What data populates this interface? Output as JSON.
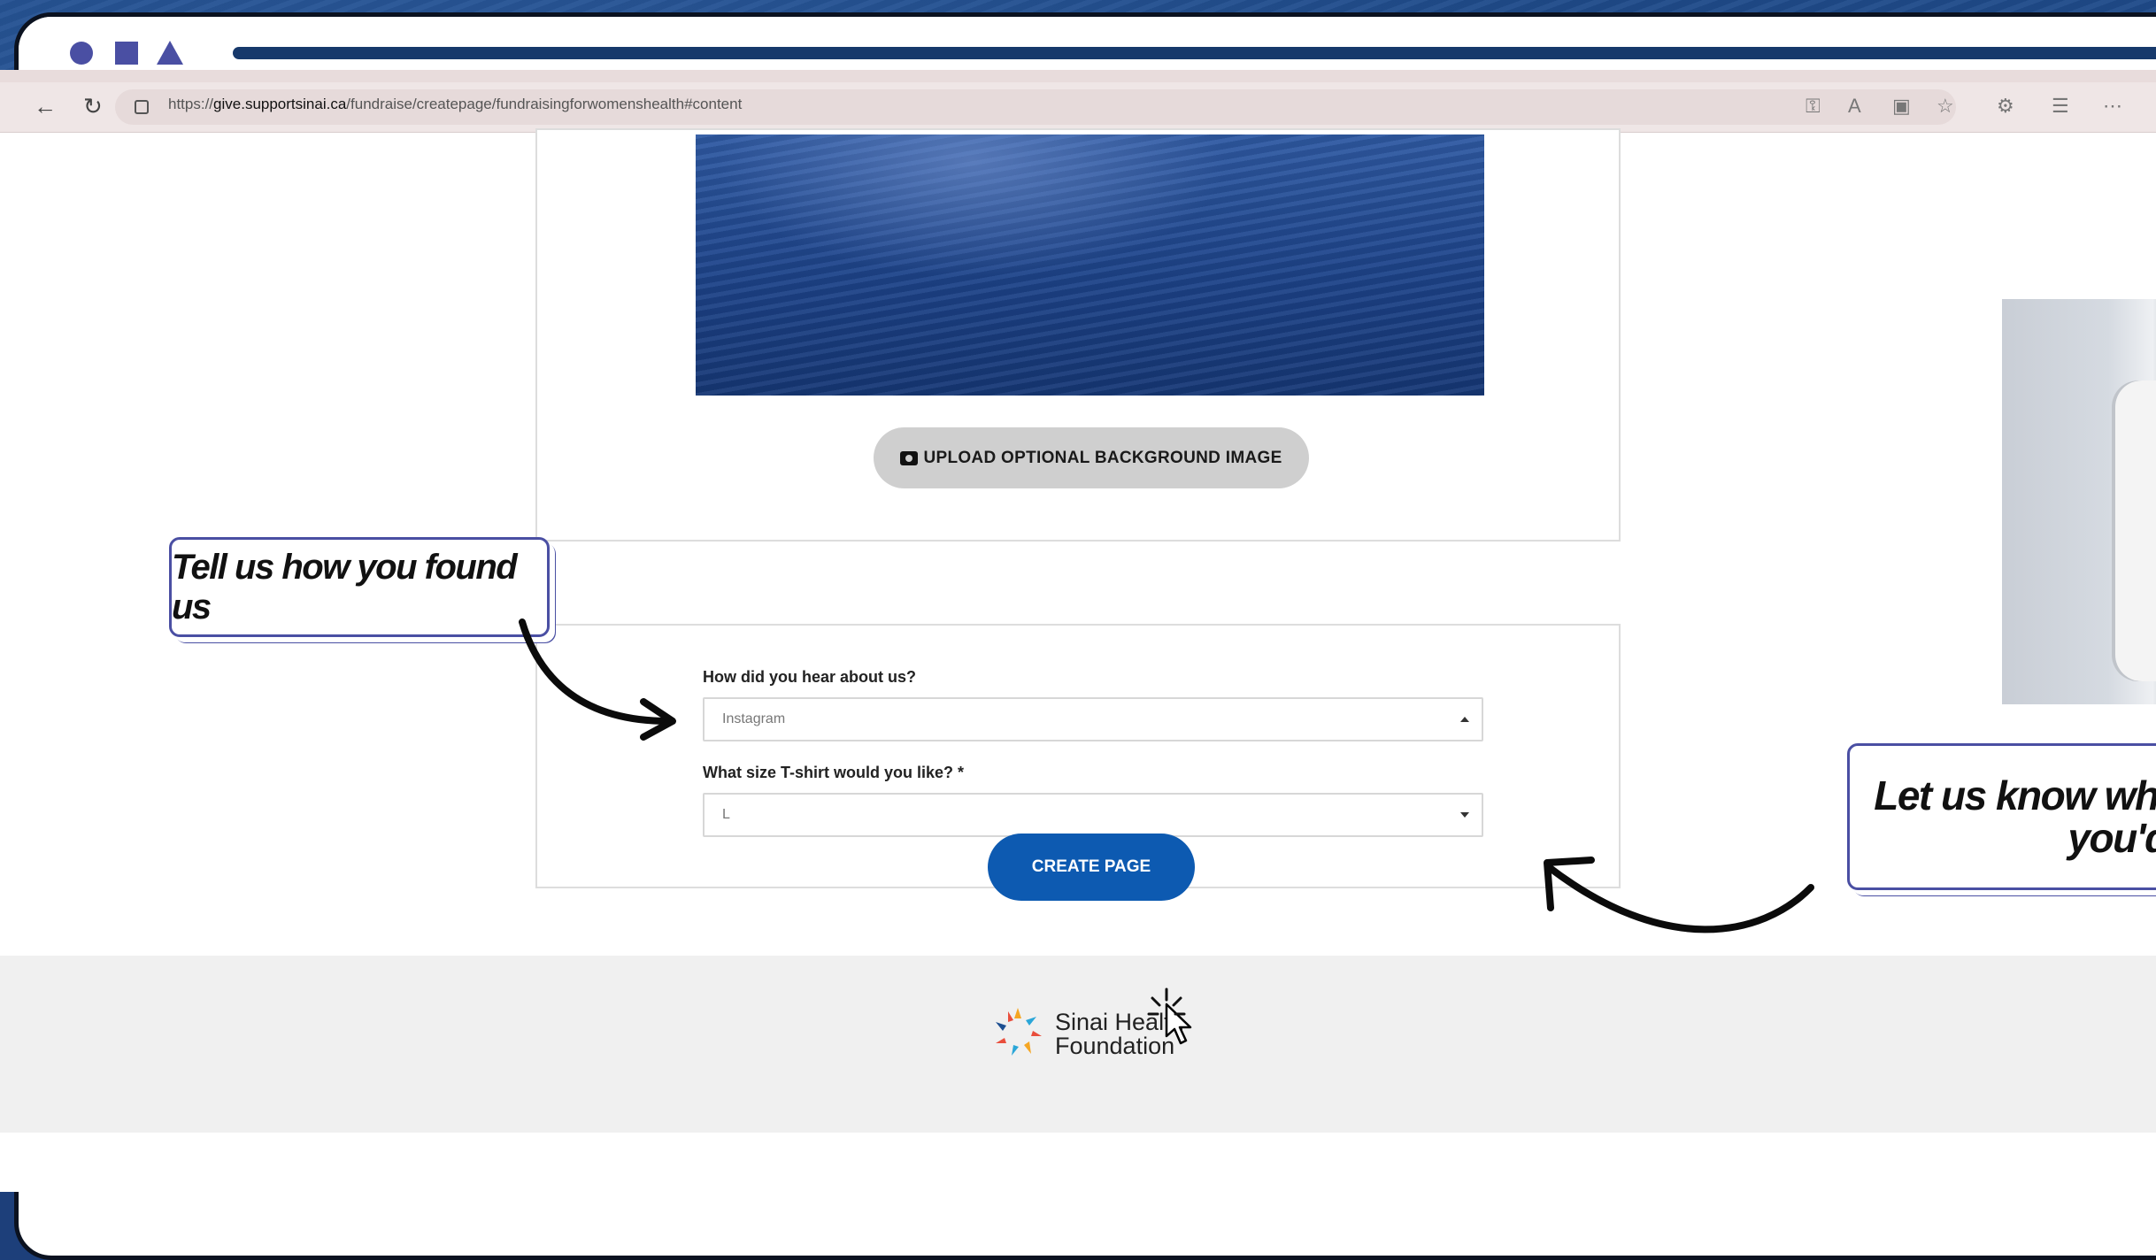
{
  "browser": {
    "url_prefix": "https://",
    "url_domain": "give.supportsinai.ca",
    "url_path": "/fundraise/createpage/fundraisingforwomenshealth#content",
    "back_icon": "back-arrow-icon",
    "reload_icon": "reload-icon",
    "toolbar_icons": [
      "key-icon",
      "read-aloud-icon",
      "immersive-reader-icon",
      "favorite-star-icon",
      "extensions-icon",
      "favorites-list-icon",
      "more-icon"
    ]
  },
  "upload": {
    "label": "UPLOAD OPTIONAL BACKGROUND IMAGE",
    "icon": "camera-icon"
  },
  "form": {
    "q1_label": "How did you hear about us?",
    "q1_value": "Instagram",
    "q2_label": "What size T-shirt would you like? *",
    "q2_value": "L"
  },
  "create_label": "CREATE PAGE",
  "footer": {
    "logo_line1": "Sinai Health",
    "logo_line2": "Foundation"
  },
  "callouts": {
    "left": "Tell us how you found us",
    "right_line1": "Let us know wha",
    "right_line2": "you'd li"
  },
  "colors": {
    "accent": "#4a4fa3",
    "primary_button": "#0d5ab1",
    "frame_dark": "#0b1220"
  }
}
